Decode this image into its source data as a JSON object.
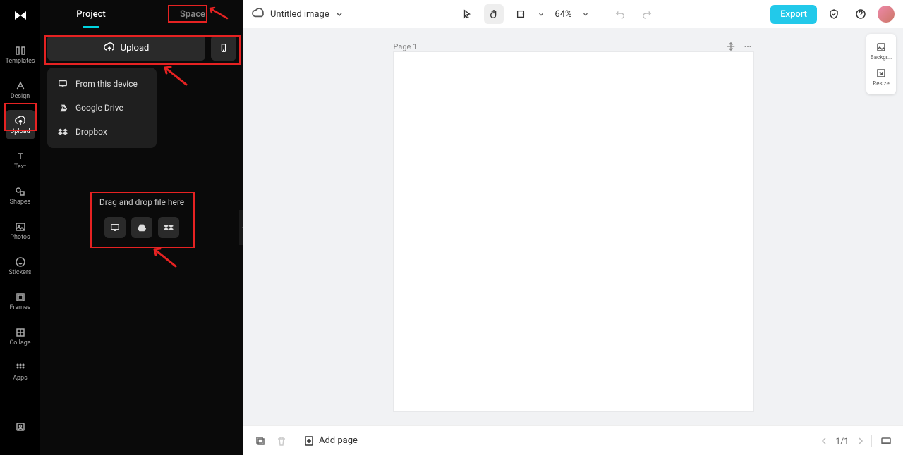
{
  "sidebar": {
    "items": [
      {
        "label": "Templates"
      },
      {
        "label": "Design"
      },
      {
        "label": "Upload"
      },
      {
        "label": "Text"
      },
      {
        "label": "Shapes"
      },
      {
        "label": "Photos"
      },
      {
        "label": "Stickers"
      },
      {
        "label": "Frames"
      },
      {
        "label": "Collage"
      },
      {
        "label": "Apps"
      }
    ]
  },
  "panel": {
    "tabs": {
      "project": "Project",
      "space": "Space"
    },
    "upload_label": "Upload",
    "dropdown": {
      "device": "From this device",
      "gdrive": "Google Drive",
      "dropbox": "Dropbox"
    },
    "drop_text": "Drag and drop file here"
  },
  "topbar": {
    "title": "Untitled image",
    "zoom": "64%",
    "export": "Export"
  },
  "canvas": {
    "page_label": "Page 1"
  },
  "right_tools": {
    "background": "Backgr...",
    "resize": "Resize"
  },
  "bottombar": {
    "add_page": "Add page",
    "pager": "1/1"
  }
}
